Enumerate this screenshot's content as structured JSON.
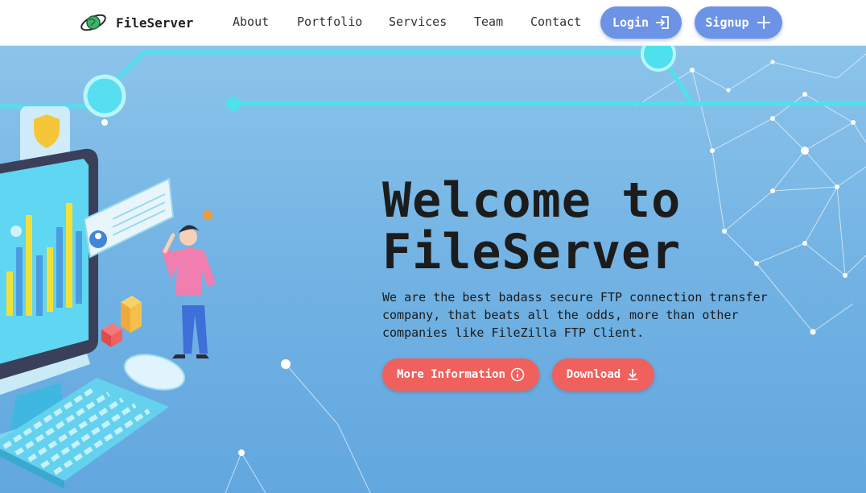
{
  "brand": {
    "name": "FileServer",
    "logo_icon": "globe-orbit-icon"
  },
  "nav": {
    "links": [
      {
        "label": "About"
      },
      {
        "label": "Portfolio"
      },
      {
        "label": "Services"
      },
      {
        "label": "Team"
      },
      {
        "label": "Contact"
      }
    ],
    "login": {
      "label": "Login",
      "icon": "sign-in-icon"
    },
    "signup": {
      "label": "Signup",
      "icon": "plus-icon"
    }
  },
  "hero": {
    "title_line1": "Welcome to",
    "title_line2": "FileServer",
    "description": "We are the best badass secure FTP connection transfer company, that beats all the odds, more than other companies like FileZilla FTP Client.",
    "more_info": {
      "label": "More Information",
      "icon": "info-circle-icon"
    },
    "download": {
      "label": "Download",
      "icon": "download-icon"
    }
  },
  "colors": {
    "nav_button": "#6c93e6",
    "cta_button": "#f0605c",
    "hero_background": "#74b4e4"
  }
}
